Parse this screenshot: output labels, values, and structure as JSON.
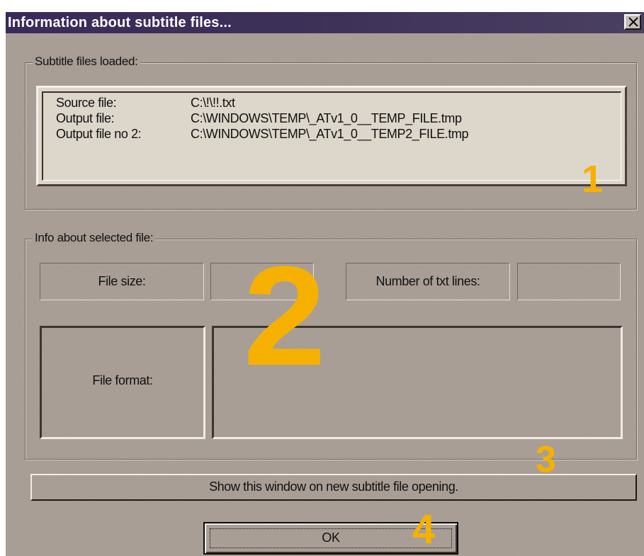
{
  "window": {
    "title": "Information about subtitle files...",
    "close_glyph": "×"
  },
  "loaded_group": {
    "legend": "Subtitle files loaded:",
    "rows": [
      {
        "label": "Source file:",
        "value": "C:\\!\\!!.txt"
      },
      {
        "label": "Output file:",
        "value": "C:\\WINDOWS\\TEMP\\_ATv1_0__TEMP_FILE.tmp"
      },
      {
        "label": "Output file no 2:",
        "value": "C:\\WINDOWS\\TEMP\\_ATv1_0__TEMP2_FILE.tmp"
      }
    ]
  },
  "info_group": {
    "legend": "Info about selected file:",
    "file_size_label": "File size:",
    "file_size_value": "",
    "lines_label": "Number of txt lines:",
    "lines_value": "",
    "format_label": "File format:",
    "format_value": ""
  },
  "show_window_option": "Show this window on new subtitle file opening.",
  "ok_label": "OK",
  "annotations": {
    "m1": "1",
    "m2": "2",
    "m3": "3",
    "m4": "4",
    "color": "#f6b100"
  },
  "colors": {
    "face": "#a79d94",
    "titlebar": "#3a2a5a",
    "listbox": "#ddd6ca"
  }
}
